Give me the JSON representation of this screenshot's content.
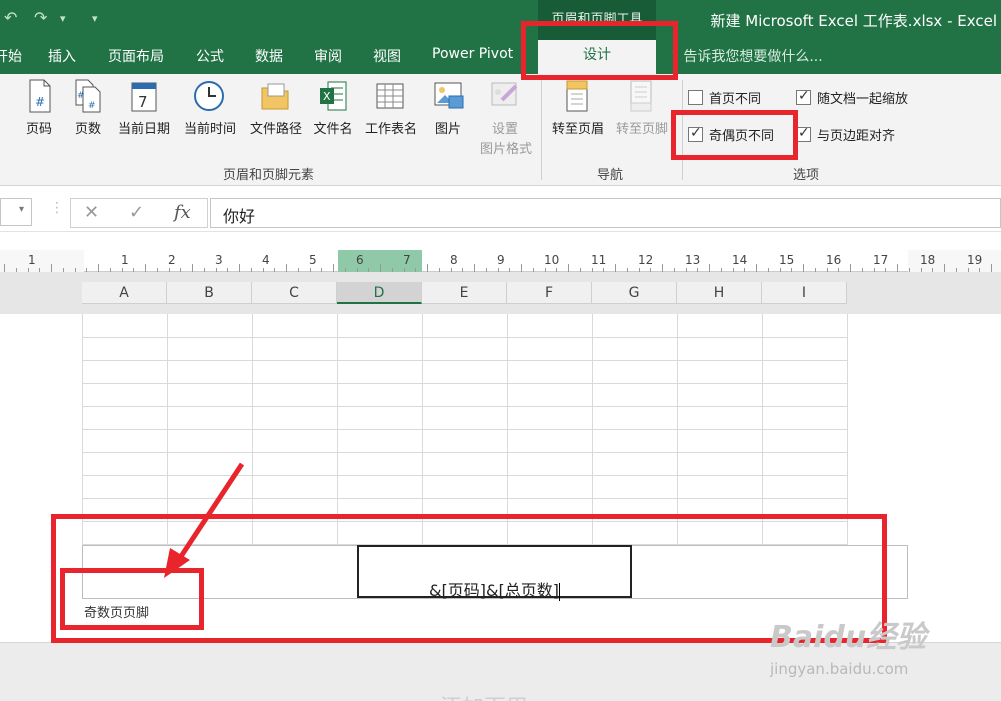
{
  "titlebar": {
    "context_tab_label": "页眉和页脚工具",
    "document_title": "新建 Microsoft Excel 工作表.xlsx - Excel"
  },
  "tabs": [
    {
      "label": "开始"
    },
    {
      "label": "插入"
    },
    {
      "label": "页面布局"
    },
    {
      "label": "公式"
    },
    {
      "label": "数据"
    },
    {
      "label": "审阅"
    },
    {
      "label": "视图"
    },
    {
      "label": "Power Pivot"
    },
    {
      "label": "设计",
      "active": true
    }
  ],
  "tell_me": "告诉我您想要做什么...",
  "ribbon": {
    "elements_group": {
      "label": "页眉和页脚元素",
      "buttons": [
        {
          "label": "页码",
          "icon": "page-number-icon"
        },
        {
          "label": "页数",
          "icon": "page-count-icon"
        },
        {
          "label": "当前日期",
          "icon": "calendar-icon"
        },
        {
          "label": "当前时间",
          "icon": "clock-icon"
        },
        {
          "label": "文件路径",
          "icon": "folder-icon"
        },
        {
          "label": "文件名",
          "icon": "excel-file-icon"
        },
        {
          "label": "工作表名",
          "icon": "sheet-grid-icon"
        },
        {
          "label": "图片",
          "icon": "picture-icon"
        },
        {
          "label": "设置",
          "label2": "图片格式",
          "icon": "format-picture-icon",
          "disabled": true
        }
      ]
    },
    "nav_group": {
      "label": "导航",
      "buttons": [
        {
          "label": "转至页眉",
          "icon": "goto-header-icon"
        },
        {
          "label": "转至页脚",
          "icon": "goto-footer-icon",
          "disabled": true
        }
      ]
    },
    "options_group": {
      "label": "选项",
      "checkboxes": [
        {
          "label": "首页不同",
          "checked": false
        },
        {
          "label": "随文档一起缩放",
          "checked": true
        },
        {
          "label": "奇偶页不同",
          "checked": true
        },
        {
          "label": "与页边距对齐",
          "checked": true
        }
      ]
    }
  },
  "formula_bar": {
    "cancel": "✕",
    "enter": "✓",
    "fx": "fx",
    "value": "你好"
  },
  "ruler": [
    "1",
    "1",
    "2",
    "3",
    "4",
    "5",
    "6",
    "7",
    "8",
    "9",
    "10",
    "11",
    "12",
    "13",
    "14",
    "15",
    "16",
    "17",
    "18",
    "19"
  ],
  "columns": [
    "A",
    "B",
    "C",
    "D",
    "E",
    "F",
    "G",
    "H",
    "I"
  ],
  "selected_column": "D",
  "footer": {
    "center_text": "&[页码]&[总页数]",
    "tag": "奇数页页脚"
  },
  "bottom_hint": "添加页眉",
  "watermark": {
    "brand": "Baidu经验",
    "url": "jingyan.baidu.com"
  },
  "colors": {
    "excel_green": "#217346",
    "highlight_red": "#e8252d"
  }
}
